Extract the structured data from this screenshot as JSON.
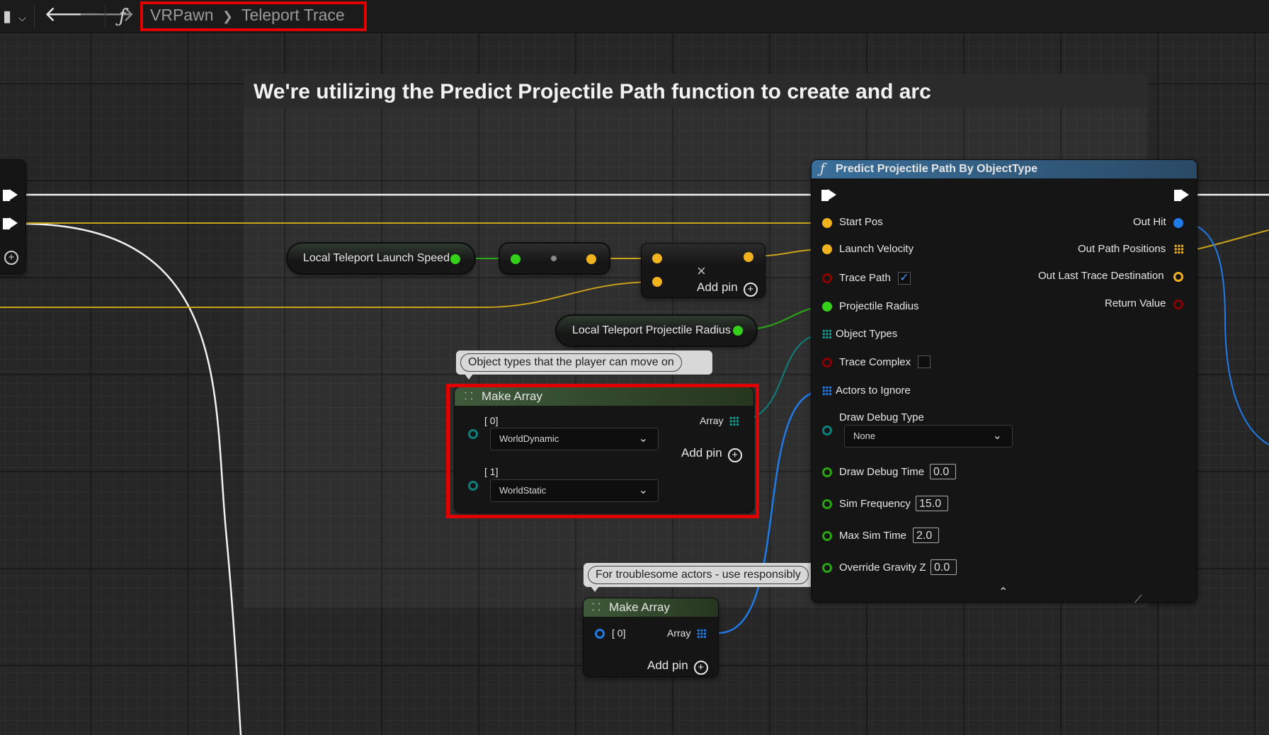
{
  "toolbar": {
    "breadcrumb_root": "VRPawn",
    "breadcrumb_sep": "❯",
    "breadcrumb_leaf": "Teleport Trace",
    "function_glyph": "ƒ",
    "icons": [
      "bookmark-icon",
      "back-arrow-icon",
      "forward-arrow-icon",
      "function-icon"
    ]
  },
  "comment": {
    "title": "We're utilizing the Predict Projectile Path function to create and arc"
  },
  "nodes": {
    "launch_speed": {
      "label": "Local Teleport Launch Speed"
    },
    "projectile_radius": {
      "label": "Local Teleport Projectile Radius"
    },
    "multiply": {
      "op": "×",
      "add_pin": "Add pin"
    },
    "make_array_1": {
      "title": "Make Array",
      "pin0_label": "[ 0]",
      "pin0_value": "WorldDynamic",
      "pin1_label": "[ 1]",
      "pin1_value": "WorldStatic",
      "out_label": "Array",
      "add_pin": "Add pin",
      "comment": "Object types that the player can move on"
    },
    "make_array_2": {
      "title": "Make Array",
      "pin0_label": "[ 0]",
      "out_label": "Array",
      "add_pin": "Add pin",
      "comment": "For troublesome actors - use responsibly"
    },
    "predict": {
      "title": "Predict Projectile Path By ObjectType",
      "inputs": {
        "start_pos": "Start Pos",
        "launch_velocity": "Launch Velocity",
        "trace_path": "Trace Path",
        "projectile_radius": "Projectile Radius",
        "object_types": "Object Types",
        "trace_complex": "Trace Complex",
        "actors_to_ignore": "Actors to Ignore",
        "draw_debug_type": "Draw Debug Type",
        "draw_debug_type_value": "None",
        "draw_debug_time": "Draw Debug Time",
        "draw_debug_time_value": "0.0",
        "sim_frequency": "Sim Frequency",
        "sim_frequency_value": "15.0",
        "max_sim_time": "Max Sim Time",
        "max_sim_time_value": "2.0",
        "override_gravity": "Override Gravity Z",
        "override_gravity_value": "0.0"
      },
      "outputs": {
        "out_hit": "Out Hit",
        "out_path_positions": "Out Path Positions",
        "out_last_trace": "Out Last Trace Destination",
        "return_value": "Return Value"
      },
      "trace_path_checked": "✓"
    }
  },
  "colors": {
    "exec": "#ffffff",
    "float_pin": "#35d11a",
    "vector_pin": "#f0b21d",
    "object_pin": "#1f7be8",
    "highlight": "#e00000"
  }
}
